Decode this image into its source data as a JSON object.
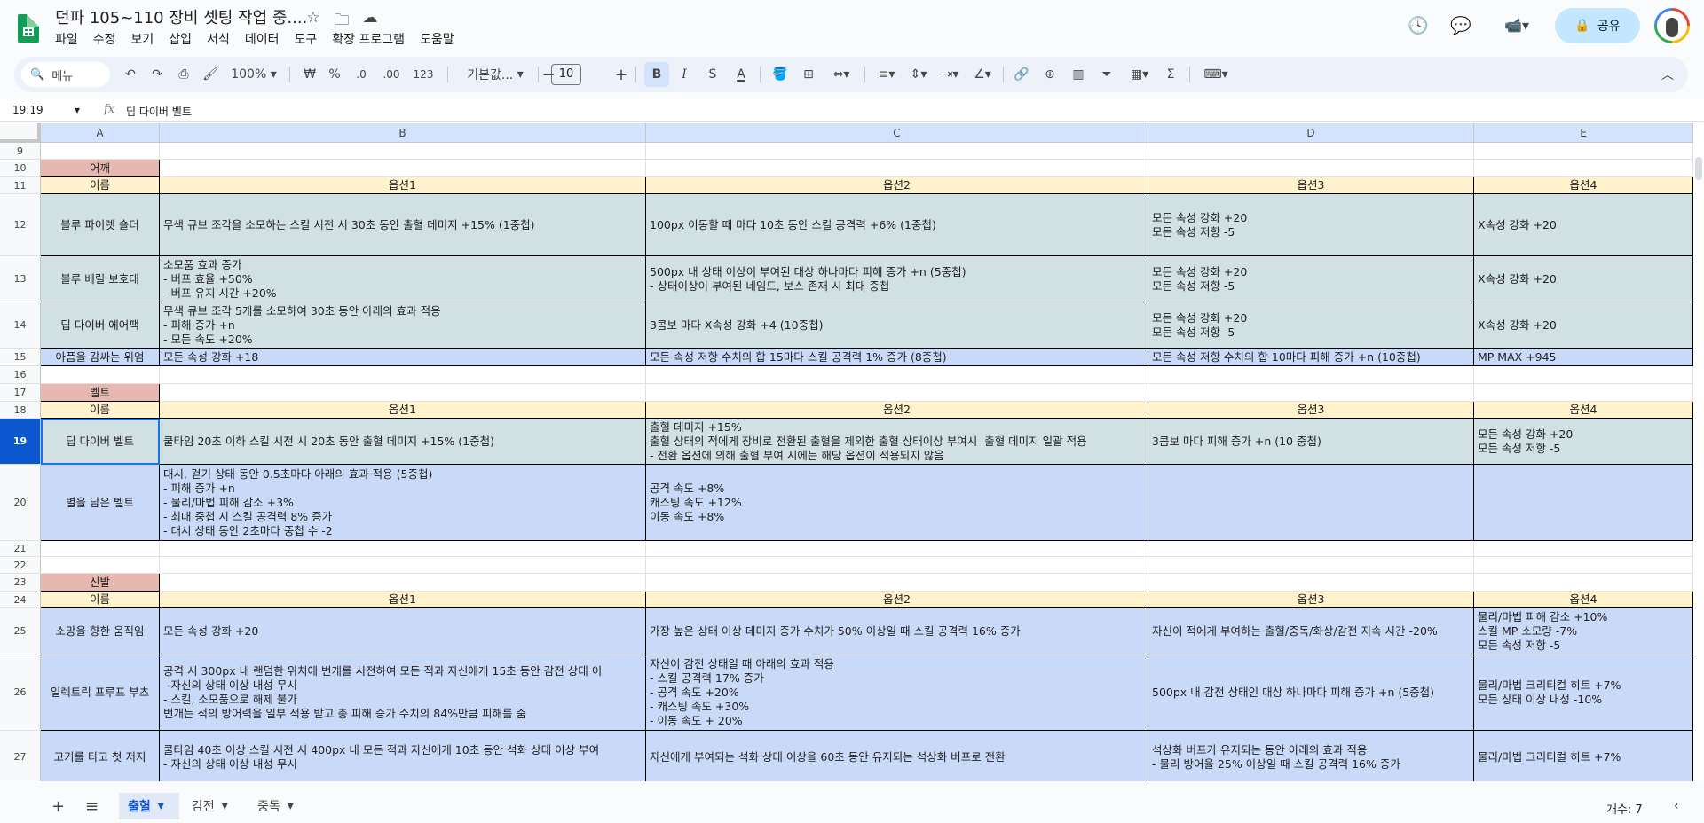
{
  "app": {
    "title": "던파 105~110 장비 셋팅 작업 중....",
    "menus": [
      "파일",
      "수정",
      "보기",
      "삽입",
      "서식",
      "데이터",
      "도구",
      "확장 프로그램",
      "도움말"
    ],
    "share_label": "공유",
    "colors": {
      "accent": "#0b57d0",
      "share": "#c2e7ff",
      "category": "#e6b8af",
      "header": "#fff2cc",
      "teal": "#d0e0e3",
      "blue": "#c9daf8"
    }
  },
  "toolbar": {
    "search_label": "메뉴",
    "zoom": "100%",
    "currency": "₩",
    "percent": "%",
    "dec_less": ".0",
    "dec_more": ".00",
    "number_fmt": "123",
    "font": "기본값...",
    "font_size": "10",
    "bold": "B",
    "italic": "I",
    "strike": "S",
    "text_color": "A"
  },
  "formula_bar": {
    "cell_ref": "19:19",
    "fx": "fx",
    "value": "딥 다이버 벨트"
  },
  "columns": [
    "A",
    "B",
    "C",
    "D",
    "E"
  ],
  "rows": [
    {
      "n": "9",
      "type": "blank",
      "cells": [
        "",
        "",
        "",
        "",
        ""
      ]
    },
    {
      "n": "10",
      "type": "cat",
      "cells": [
        "어깨",
        "",
        "",
        "",
        ""
      ]
    },
    {
      "n": "11",
      "type": "hdr",
      "cells": [
        "이름",
        "옵션1",
        "옵션2",
        "옵션3",
        "옵션4"
      ]
    },
    {
      "n": "12",
      "type": "teal",
      "cells": [
        "블루 파이렛 숄더",
        "무색 큐브 조각을 소모하는 스킬 시전 시 30초 동안 출혈 데미지 +15% (1중첩)",
        "100px 이동할 때 마다 10초 동안 스킬 공격력 +6% (1중첩)",
        "모든 속성 강화 +20\n모든 속성 저항 -5",
        "X속성 강화 +20"
      ]
    },
    {
      "n": "13",
      "type": "teal",
      "cells": [
        "블루 베릴 보호대",
        "소모품 효과 증가\n- 버프 효율 +50%\n- 버프 유지 시간 +20%",
        "500px 내 상태 이상이 부여된 대상 하나마다 피해 증가 +n (5중첩)\n- 상태이상이 부여된 네임드, 보스 존재 시 최대 중첩",
        "모든 속성 강화 +20\n모든 속성 저항 -5",
        "X속성 강화 +20"
      ]
    },
    {
      "n": "14",
      "type": "teal",
      "cells": [
        "딥 다이버 에어팩",
        "무색 큐브 조각 5개를 소모하여 30초 동안 아래의 효과 적용\n- 피해 증가 +n\n- 모든 속도 +20%",
        "3콤보 마다 X속성 강화 +4 (10중첩)",
        "모든 속성 강화 +20\n모든 속성 저항 -5",
        "X속성 강화 +20"
      ]
    },
    {
      "n": "15",
      "type": "blue",
      "cells": [
        "아픔을 감싸는 위엄",
        "모든 속성 강화 +18",
        "모든 속성 저항 수치의 합 15마다 스킬 공격력 1% 증가 (8중첩)",
        "모든 속성 저항 수치의 합 10마다 피해 증가 +n (10중첩)",
        "MP MAX +945"
      ]
    },
    {
      "n": "16",
      "type": "blank",
      "cells": [
        "",
        "",
        "",
        "",
        ""
      ]
    },
    {
      "n": "17",
      "type": "cat",
      "cells": [
        "벨트",
        "",
        "",
        "",
        ""
      ]
    },
    {
      "n": "18",
      "type": "hdr",
      "cells": [
        "이름",
        "옵션1",
        "옵션2",
        "옵션3",
        "옵션4"
      ]
    },
    {
      "n": "19",
      "type": "teal",
      "cells": [
        "딥 다이버 벨트",
        "쿨타임 20초 이하 스킬 시전 시 20초 동안 출혈 데미지 +15% (1중첩)",
        "출혈 데미지 +15%\n출혈 상태의 적에게 장비로 전환된 출혈을 제외한 출혈 상태이상 부여시  출혈 데미지 일괄 적용\n- 전환 옵션에 의해 출혈 부여 시에는 해당 옵션이 적용되지 않음",
        "3콤보 마다 피해 증가 +n (10 중첩)",
        "모든 속성 강화 +20\n모든 속성 저항 -5"
      ]
    },
    {
      "n": "20",
      "type": "blue",
      "cells": [
        "별을 담은 벨트",
        "대시, 걷기 상태 동안 0.5초마다 아래의 효과 적용 (5중첩)\n- 피해 증가 +n\n- 물리/마법 피해 감소 +3%\n- 최대 중첩 시 스킬 공격력 8% 증가\n- 대시 상태 동안 2초마다 중첩 수 -2",
        "공격 속도 +8%\n캐스팅 속도 +12%\n이동 속도 +8%",
        "",
        ""
      ]
    },
    {
      "n": "21",
      "type": "blank",
      "cells": [
        "",
        "",
        "",
        "",
        ""
      ]
    },
    {
      "n": "22",
      "type": "blank",
      "cells": [
        "",
        "",
        "",
        "",
        ""
      ]
    },
    {
      "n": "23",
      "type": "cat",
      "cells": [
        "신발",
        "",
        "",
        "",
        ""
      ]
    },
    {
      "n": "24",
      "type": "hdr",
      "cells": [
        "이름",
        "옵션1",
        "옵션2",
        "옵션3",
        "옵션4"
      ]
    },
    {
      "n": "25",
      "type": "blue",
      "cells": [
        "소망을 향한 움직임",
        "모든 속성 강화 +20",
        "가장 높은 상태 이상 데미지 증가 수치가 50% 이상일 때 스킬 공격력 16% 증가",
        "자신이 적에게 부여하는 출혈/중독/화상/감전 지속 시간 -20%",
        "물리/마법 피해 감소 +10%\n스킬 MP 소모량 -7%\n모든 속성 저항 -5"
      ]
    },
    {
      "n": "26",
      "type": "blue",
      "cells": [
        "일렉트릭 프루프 부츠",
        "공격 시 300px 내 랜덤한 위치에 번개를 시전하여 모든 적과 자신에게 15초 동안 감전 상태 이\n- 자신의 상태 이상 내성 무시\n- 스킬, 소모품으로 해제 불가\n번개는 적의 방어력을 일부 적용 받고 총 피해 증가 수치의 84%만큼 피해를 줌",
        "자신이 감전 상태일 때 아래의 효과 적용\n- 스킬 공격력 17% 증가\n- 공격 속도 +20%\n- 캐스팅 속도 +30%\n- 이동 속도 + 20%",
        "500px 내 감전 상태인 대상 하나마다 피해 증가 +n (5중첩)",
        "물리/마법 크리티컬 히트 +7%\n모든 상태 이상 내성 -10%"
      ]
    },
    {
      "n": "27",
      "type": "blue",
      "cells": [
        "고기를 타고 첫 저지",
        "쿨타임 40초 이상 스킬 시전 시 400px 내 모든 적과 자신에게 10초 동안 석화 상태 이상 부여\n- 자신의 상태 이상 내성 무시",
        "자신에게 부여되는 석화 상태 이상을 60초 동안 유지되는 석상화 버프로 전환",
        "석상화 버프가 유지되는 동안 아래의 효과 적용\n- 물리 방어율 25% 이상일 때 스킬 공격력 16% 증가",
        "물리/마법 크리티컬 히트 +7%"
      ]
    }
  ],
  "sheets": {
    "tabs": [
      {
        "label": "출혈",
        "active": true
      },
      {
        "label": "감전",
        "active": false
      },
      {
        "label": "중독",
        "active": false
      }
    ],
    "count_label": "개수: 7"
  }
}
